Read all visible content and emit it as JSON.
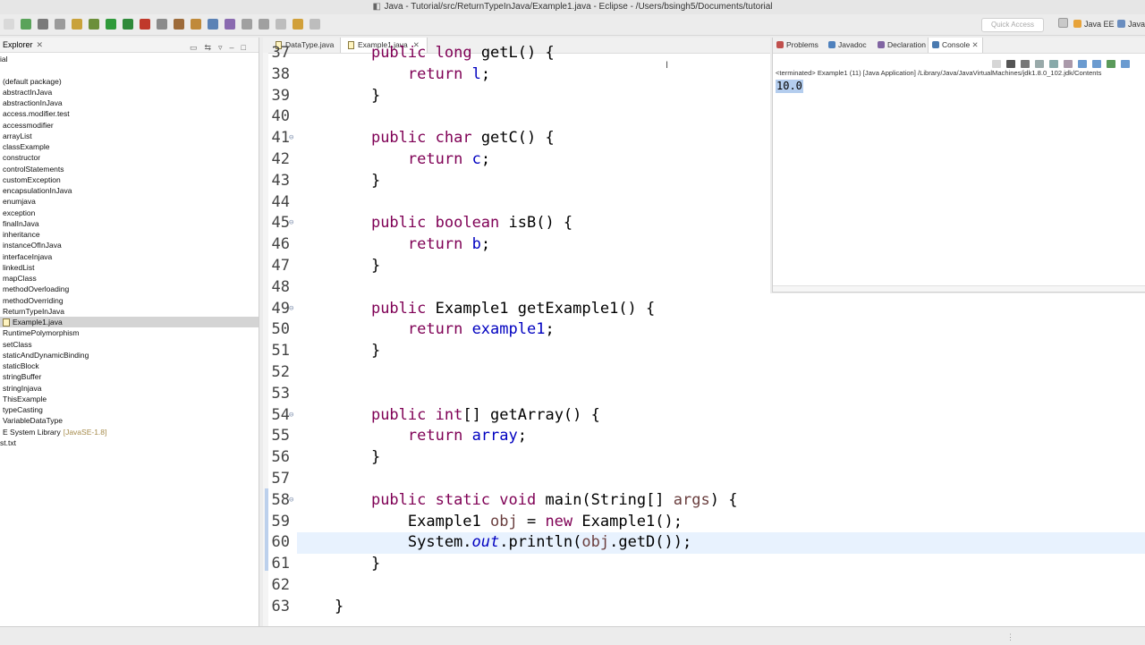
{
  "window": {
    "title": "Java - Tutorial/src/ReturnTypeInJava/Example1.java - Eclipse - /Users/bsingh5/Documents/tutorial"
  },
  "toolbar": {
    "quick_access_placeholder": "Quick Access",
    "perspectives": [
      "Java EE",
      "Java"
    ],
    "icons": [
      "new-icon",
      "save-icon",
      "save-all-icon",
      "print-icon",
      "refresh-icon",
      "debug-icon",
      "run-icon",
      "coverage-icon",
      "external-tools-icon",
      "new-java-project-icon",
      "new-package-icon",
      "new-class-icon",
      "open-type-icon",
      "search-icon",
      "next-annotation-icon",
      "prev-annotation-icon",
      "last-edit-icon",
      "back-icon",
      "forward-icon"
    ]
  },
  "explorer": {
    "tab_label": "Explorer",
    "tree": [
      {
        "label": "ial",
        "kind": "root"
      },
      {
        "label": "",
        "kind": "root"
      },
      {
        "label": "(default package)",
        "kind": "package"
      },
      {
        "label": "abstractInJava",
        "kind": "package"
      },
      {
        "label": "abstractionInJava",
        "kind": "package"
      },
      {
        "label": "access.modifier.test",
        "kind": "package"
      },
      {
        "label": "accessmodifier",
        "kind": "package"
      },
      {
        "label": "arrayList",
        "kind": "package"
      },
      {
        "label": "classExample",
        "kind": "package"
      },
      {
        "label": "constructor",
        "kind": "package"
      },
      {
        "label": "controlStatements",
        "kind": "package"
      },
      {
        "label": "customException",
        "kind": "package"
      },
      {
        "label": "encapsulationInJava",
        "kind": "package"
      },
      {
        "label": "enumjava",
        "kind": "package"
      },
      {
        "label": "exception",
        "kind": "package"
      },
      {
        "label": "finalInJava",
        "kind": "package"
      },
      {
        "label": "inheritance",
        "kind": "package"
      },
      {
        "label": "instanceOfInJava",
        "kind": "package"
      },
      {
        "label": "interfaceInjava",
        "kind": "package"
      },
      {
        "label": "linkedList",
        "kind": "package"
      },
      {
        "label": "mapClass",
        "kind": "package"
      },
      {
        "label": "methodOverloading",
        "kind": "package"
      },
      {
        "label": "methodOverriding",
        "kind": "package"
      },
      {
        "label": "ReturnTypeInJava",
        "kind": "package"
      },
      {
        "label": "Example1.java",
        "kind": "file",
        "selected": true
      },
      {
        "label": "RuntimePolymorphism",
        "kind": "package"
      },
      {
        "label": "setClass",
        "kind": "package"
      },
      {
        "label": "staticAndDynamicBinding",
        "kind": "package"
      },
      {
        "label": "staticBlock",
        "kind": "package"
      },
      {
        "label": "stringBuffer",
        "kind": "package"
      },
      {
        "label": "stringInjava",
        "kind": "package"
      },
      {
        "label": "ThisExample",
        "kind": "package"
      },
      {
        "label": "typeCasting",
        "kind": "package"
      },
      {
        "label": "VariableDataType",
        "kind": "package"
      },
      {
        "label": "E System Library",
        "suffix": "[JavaSE-1.8]",
        "kind": "library"
      },
      {
        "label": "st.txt",
        "kind": "root"
      }
    ]
  },
  "editor": {
    "tabs": [
      {
        "label": "DataType.java",
        "active": false
      },
      {
        "label": "Example1.java",
        "active": true
      }
    ],
    "lines": [
      {
        "n": "37",
        "fold": false,
        "tokens": [
          [
            "    ",
            ""
          ],
          [
            "public",
            "kw"
          ],
          [
            " ",
            ""
          ],
          [
            "long",
            "kw"
          ],
          [
            " getL() {",
            ""
          ]
        ]
      },
      {
        "n": "38",
        "fold": false,
        "tokens": [
          [
            "        ",
            ""
          ],
          [
            "return",
            "kw"
          ],
          [
            " ",
            ""
          ],
          [
            "l",
            "fld"
          ],
          [
            ";",
            ""
          ]
        ]
      },
      {
        "n": "39",
        "fold": false,
        "tokens": [
          [
            "    }",
            ""
          ]
        ]
      },
      {
        "n": "40",
        "fold": false,
        "tokens": [
          [
            "",
            ""
          ]
        ]
      },
      {
        "n": "41",
        "fold": true,
        "tokens": [
          [
            "    ",
            ""
          ],
          [
            "public",
            "kw"
          ],
          [
            " ",
            ""
          ],
          [
            "char",
            "kw"
          ],
          [
            " getC() {",
            ""
          ]
        ]
      },
      {
        "n": "42",
        "fold": false,
        "tokens": [
          [
            "        ",
            ""
          ],
          [
            "return",
            "kw"
          ],
          [
            " ",
            ""
          ],
          [
            "c",
            "fld"
          ],
          [
            ";",
            ""
          ]
        ]
      },
      {
        "n": "43",
        "fold": false,
        "tokens": [
          [
            "    }",
            ""
          ]
        ]
      },
      {
        "n": "44",
        "fold": false,
        "tokens": [
          [
            "",
            ""
          ]
        ]
      },
      {
        "n": "45",
        "fold": true,
        "tokens": [
          [
            "    ",
            ""
          ],
          [
            "public",
            "kw"
          ],
          [
            " ",
            ""
          ],
          [
            "boolean",
            "kw"
          ],
          [
            " isB() {",
            ""
          ]
        ]
      },
      {
        "n": "46",
        "fold": false,
        "tokens": [
          [
            "        ",
            ""
          ],
          [
            "return",
            "kw"
          ],
          [
            " ",
            ""
          ],
          [
            "b",
            "fld"
          ],
          [
            ";",
            ""
          ]
        ]
      },
      {
        "n": "47",
        "fold": false,
        "tokens": [
          [
            "    }",
            ""
          ]
        ]
      },
      {
        "n": "48",
        "fold": false,
        "tokens": [
          [
            "",
            ""
          ]
        ]
      },
      {
        "n": "49",
        "fold": true,
        "tokens": [
          [
            "    ",
            ""
          ],
          [
            "public",
            "kw"
          ],
          [
            " Example1 getExample1() {",
            ""
          ]
        ]
      },
      {
        "n": "50",
        "fold": false,
        "tokens": [
          [
            "        ",
            ""
          ],
          [
            "return",
            "kw"
          ],
          [
            " ",
            ""
          ],
          [
            "example1",
            "fld"
          ],
          [
            ";",
            ""
          ]
        ]
      },
      {
        "n": "51",
        "fold": false,
        "tokens": [
          [
            "    }",
            ""
          ]
        ]
      },
      {
        "n": "52",
        "fold": false,
        "tokens": [
          [
            "",
            ""
          ]
        ]
      },
      {
        "n": "53",
        "fold": false,
        "tokens": [
          [
            "",
            ""
          ]
        ]
      },
      {
        "n": "54",
        "fold": true,
        "tokens": [
          [
            "    ",
            ""
          ],
          [
            "public",
            "kw"
          ],
          [
            " ",
            ""
          ],
          [
            "int",
            "kw"
          ],
          [
            "[] getArray() {",
            ""
          ]
        ]
      },
      {
        "n": "55",
        "fold": false,
        "tokens": [
          [
            "        ",
            ""
          ],
          [
            "return",
            "kw"
          ],
          [
            " ",
            ""
          ],
          [
            "array",
            "fld"
          ],
          [
            ";",
            ""
          ]
        ]
      },
      {
        "n": "56",
        "fold": false,
        "tokens": [
          [
            "    }",
            ""
          ]
        ]
      },
      {
        "n": "57",
        "fold": false,
        "tokens": [
          [
            "",
            ""
          ]
        ]
      },
      {
        "n": "58",
        "fold": true,
        "tokens": [
          [
            "    ",
            ""
          ],
          [
            "public",
            "kw"
          ],
          [
            " ",
            ""
          ],
          [
            "static",
            "kw"
          ],
          [
            " ",
            ""
          ],
          [
            "void",
            "kw"
          ],
          [
            " main(String[] ",
            ""
          ],
          [
            "args",
            "lv"
          ],
          [
            ") {",
            ""
          ]
        ]
      },
      {
        "n": "59",
        "fold": false,
        "tokens": [
          [
            "        Example1 ",
            ""
          ],
          [
            "obj",
            "lv"
          ],
          [
            " = ",
            ""
          ],
          [
            "new",
            "kw"
          ],
          [
            " Example1();",
            ""
          ]
        ]
      },
      {
        "n": "60",
        "fold": false,
        "highlight": true,
        "tokens": [
          [
            "        System.",
            ""
          ],
          [
            "out",
            "st"
          ],
          [
            ".println(",
            ""
          ],
          [
            "obj",
            "lv"
          ],
          [
            ".getD());",
            ""
          ]
        ]
      },
      {
        "n": "61",
        "fold": false,
        "tokens": [
          [
            "    }",
            ""
          ]
        ]
      },
      {
        "n": "62",
        "fold": false,
        "tokens": [
          [
            "",
            ""
          ]
        ]
      },
      {
        "n": "63",
        "fold": false,
        "tokens": [
          [
            "}",
            ""
          ]
        ]
      }
    ]
  },
  "console": {
    "tabs": [
      {
        "label": "Problems",
        "icon": "problems-icon",
        "active": false
      },
      {
        "label": "Javadoc",
        "icon": "javadoc-icon",
        "active": false
      },
      {
        "label": "Declaration",
        "icon": "declaration-icon",
        "active": false
      },
      {
        "label": "Console",
        "icon": "console-icon",
        "active": true
      }
    ],
    "status": "<terminated> Example1 (11) [Java Application] /Library/Java/JavaVirtualMachines/jdk1.8.0_102.jdk/Contents",
    "output": "10.0"
  },
  "colors": {
    "keyword": "#7f0055",
    "field": "#0000c0",
    "local": "#6a3e3e",
    "highlight_line": "#e8f2fe",
    "selection": "#b4cdee"
  }
}
